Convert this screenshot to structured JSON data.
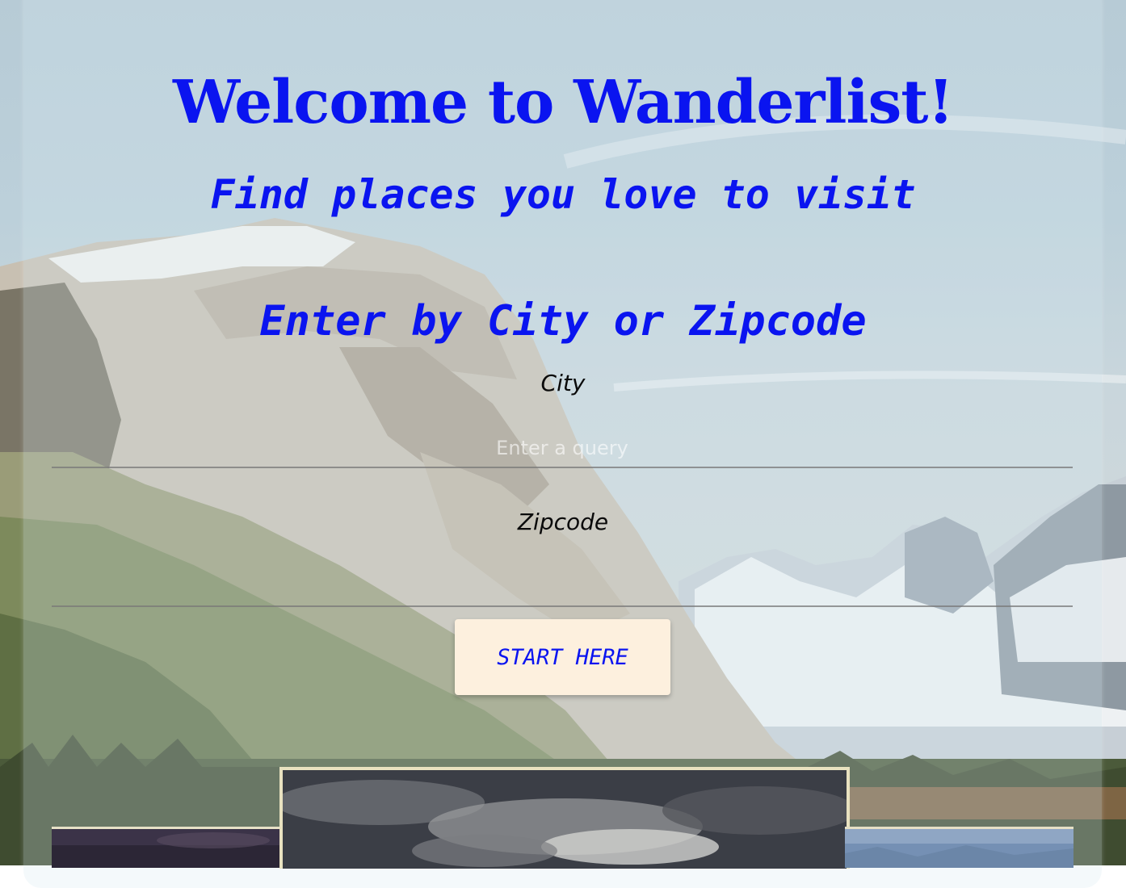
{
  "hero": {
    "title": "Welcome to Wanderlist!",
    "subtitle": "Find places you love to visit"
  },
  "search": {
    "heading": "Enter by City or Zipcode",
    "city_label": "City",
    "city_placeholder": "Enter a query",
    "city_value": "",
    "zip_label": "Zipcode",
    "zip_placeholder": "",
    "zip_value": "",
    "submit_label": "START HERE"
  },
  "colors": {
    "accent": "#0a14f0",
    "button_bg": "#fdf0de",
    "label_text": "#0a0a0a"
  }
}
